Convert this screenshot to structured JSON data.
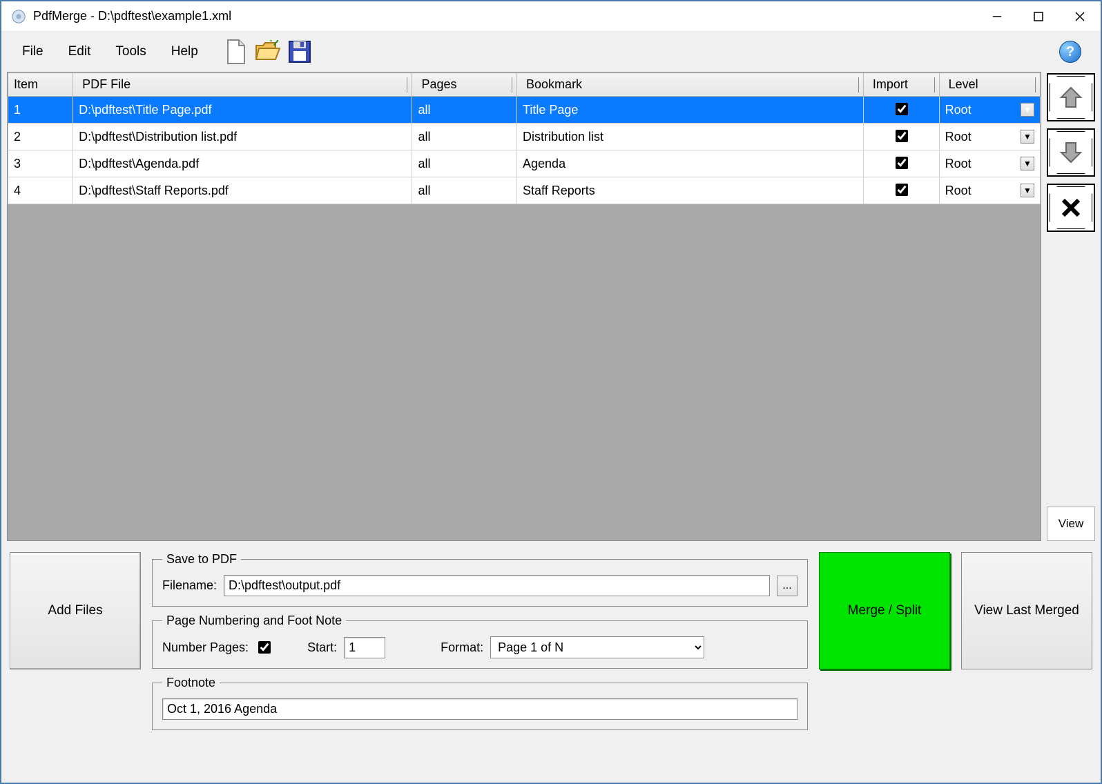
{
  "window": {
    "title": "PdfMerge - D:\\pdftest\\example1.xml"
  },
  "menu": {
    "file": "File",
    "edit": "Edit",
    "tools": "Tools",
    "help": "Help"
  },
  "table": {
    "headers": {
      "item": "Item",
      "file": "PDF File",
      "pages": "Pages",
      "bookmark": "Bookmark",
      "import": "Import",
      "level": "Level"
    },
    "rows": [
      {
        "n": "1",
        "file": "D:\\pdftest\\Title Page.pdf",
        "pages": "all",
        "bookmark": "Title Page",
        "import": true,
        "level": "Root",
        "selected": true
      },
      {
        "n": "2",
        "file": "D:\\pdftest\\Distribution list.pdf",
        "pages": "all",
        "bookmark": "Distribution list",
        "import": true,
        "level": "Root",
        "selected": false
      },
      {
        "n": "3",
        "file": "D:\\pdftest\\Agenda.pdf",
        "pages": "all",
        "bookmark": "Agenda",
        "import": true,
        "level": "Root",
        "selected": false
      },
      {
        "n": "4",
        "file": "D:\\pdftest\\Staff Reports.pdf",
        "pages": "all",
        "bookmark": "Staff Reports",
        "import": true,
        "level": "Root",
        "selected": false
      }
    ]
  },
  "side": {
    "view": "View"
  },
  "bottom": {
    "addfiles": "Add Files",
    "save": {
      "legend": "Save to PDF",
      "filename_label": "Filename:",
      "filename_value": "D:\\pdftest\\output.pdf",
      "browse": "..."
    },
    "numbering": {
      "legend": "Page Numbering and Foot Note",
      "number_pages_label": "Number Pages:",
      "number_pages_checked": true,
      "start_label": "Start:",
      "start_value": "1",
      "format_label": "Format:",
      "format_value": "Page 1 of N"
    },
    "footnote": {
      "legend": "Footnote",
      "value": "Oct 1, 2016 Agenda"
    },
    "merge": "Merge / Split",
    "viewlast": "View Last Merged"
  }
}
